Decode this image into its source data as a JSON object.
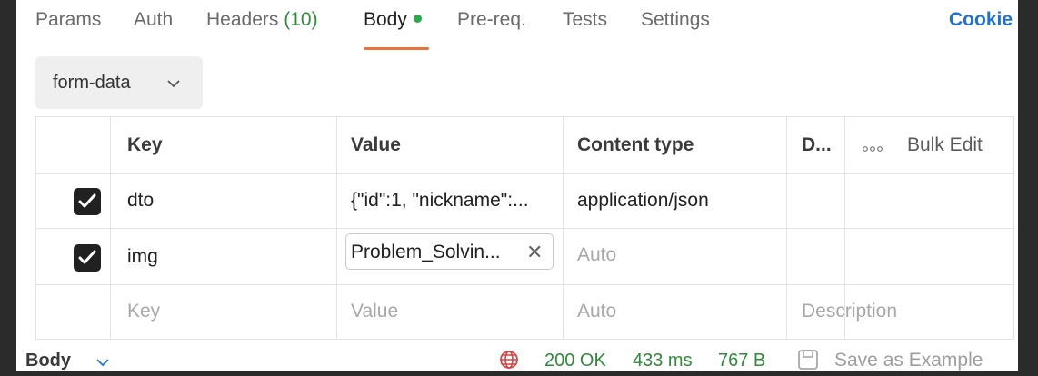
{
  "tabs": [
    {
      "label": "Params"
    },
    {
      "label": "Auth"
    },
    {
      "label": "Headers",
      "count": "(10)"
    },
    {
      "label": "Body"
    },
    {
      "label": "Pre-req."
    },
    {
      "label": "Tests"
    },
    {
      "label": "Settings"
    }
  ],
  "cookies_label": "Cookie",
  "body_type": "form-data",
  "table": {
    "headers": {
      "key": "Key",
      "value": "Value",
      "content_type": "Content type",
      "description": "D...",
      "bulk_edit": "Bulk Edit"
    },
    "rows": [
      {
        "key": "dto",
        "value": "{\"id\":1, \"nickname\":...",
        "content_type": "application/json"
      },
      {
        "key": "img",
        "file": "Problem_Solvin...",
        "content_type_placeholder": "Auto"
      }
    ],
    "new_row": {
      "key": "Key",
      "value": "Value",
      "content_type": "Auto",
      "description": "Description"
    }
  },
  "bottom": {
    "body_label": "Body",
    "status": "200 OK",
    "time": "433 ms",
    "size": "767 B",
    "save_example": "Save as Example"
  },
  "colors": {
    "accent": "#e8743b",
    "success": "#2f8a3a",
    "link": "#1e6fd9"
  }
}
